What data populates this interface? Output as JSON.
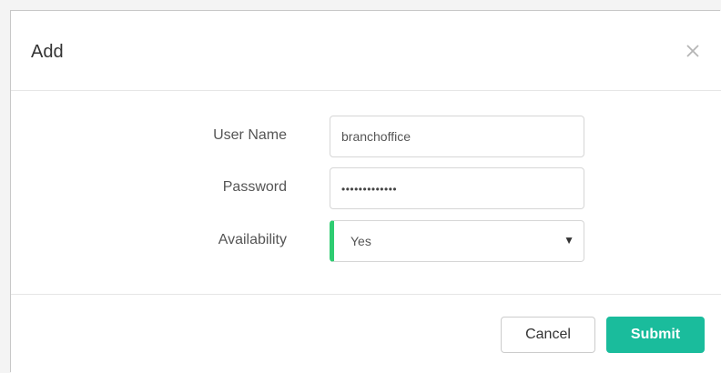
{
  "dialog": {
    "title": "Add",
    "close_icon": "close-icon"
  },
  "form": {
    "username": {
      "label": "User Name",
      "value": "branchoffice"
    },
    "password": {
      "label": "Password",
      "masked_value": "•••••••••••••"
    },
    "availability": {
      "label": "Availability",
      "selected": "Yes",
      "accent_color": "#2ecc71"
    }
  },
  "footer": {
    "cancel_label": "Cancel",
    "submit_label": "Submit",
    "submit_color": "#1abc9c"
  }
}
